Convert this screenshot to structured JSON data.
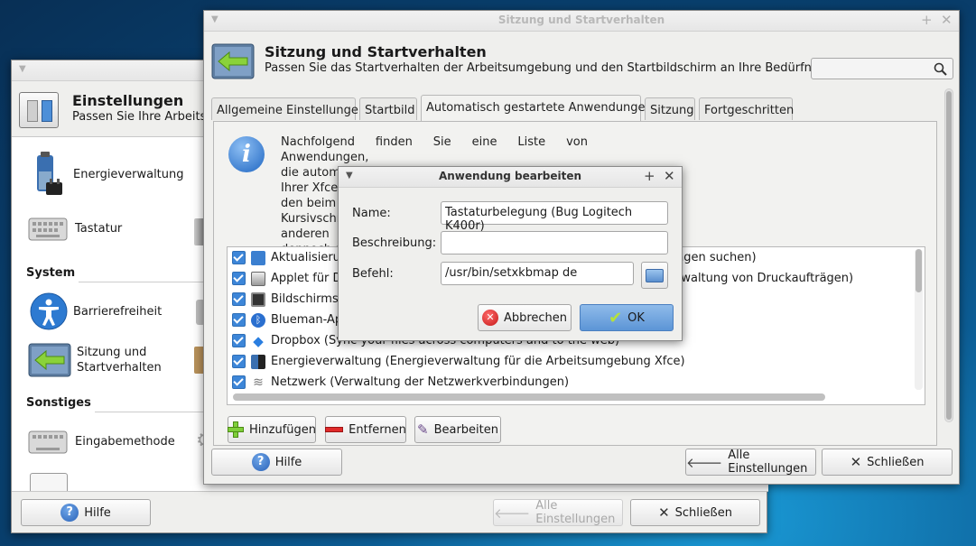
{
  "settings_window": {
    "title": "Einstellungen",
    "subtitle": "Passen Sie Ihre Arbeitsu",
    "items": [
      {
        "label": "Energieverwaltung"
      },
      {
        "label": "Tastatur"
      },
      {
        "label": "Barrierefreiheit"
      },
      {
        "label": "Sitzung und\nStartverhalten"
      },
      {
        "label": "Eingabemethode"
      }
    ],
    "sections": [
      "System",
      "Sonstiges"
    ],
    "buttons": {
      "help": "Hilfe",
      "all_settings": "Alle Einstellungen",
      "close": "Schließen"
    }
  },
  "session_window": {
    "titlebar": "Sitzung und Startverhalten",
    "title": "Sitzung und Startverhalten",
    "subtitle": "Passen Sie das Startverhalten der Arbeitsumgebung und den Startbildschirm an Ihre Bedürfnisse an",
    "tabs": [
      {
        "label": "Allgemeine Einstellungen"
      },
      {
        "label": "Startbild"
      },
      {
        "label": "Automatisch gestartete Anwendungen"
      },
      {
        "label": "Sitzung"
      },
      {
        "label": "Fortgeschritten"
      }
    ],
    "info_lines": [
      "Nachfolgend finden Sie eine Liste von Anwendungen,",
      "die automatisch gestartet werden, wenn Sie sich an",
      "Ihrer Xfce",
      "den beim",
      "Kursivschri",
      "anderen",
      "dennoch a"
    ],
    "apps": [
      {
        "left": "Aktualisierun",
        "right": "ngen suchen)"
      },
      {
        "left": "Applet für Dr",
        "right": "rwaltung von Druckaufträgen)"
      },
      {
        "left": "Bildschirmsc",
        "right": ""
      },
      {
        "left": "Blueman-Ap",
        "right": ""
      },
      {
        "left": "Dropbox (Sync your files across computers and to the web)",
        "right": ""
      },
      {
        "left": "Energieverwaltung (Energieverwaltung für die Arbeitsumgebung Xfce)",
        "right": ""
      },
      {
        "left": "Netzwerk (Verwaltung der Netzwerkverbindungen)",
        "right": ""
      }
    ],
    "list_buttons": {
      "add": "Hinzufügen",
      "remove": "Entfernen",
      "edit": "Bearbeiten"
    },
    "buttons": {
      "help": "Hilfe",
      "all_settings": "Alle Einstellungen",
      "close": "Schließen"
    }
  },
  "dialog": {
    "title": "Anwendung bearbeiten",
    "name_label": "Name:",
    "name_value": "Tastaturbelegung (Bug Logitech K400r)",
    "desc_label": "Beschreibung:",
    "desc_value": "",
    "cmd_label": "Befehl:",
    "cmd_value": "/usr/bin/setxkbmap de",
    "cancel": "Abbrechen",
    "ok": "OK"
  },
  "colors": {
    "accent": "#5c95d6",
    "desktop": "#0c5d95"
  }
}
